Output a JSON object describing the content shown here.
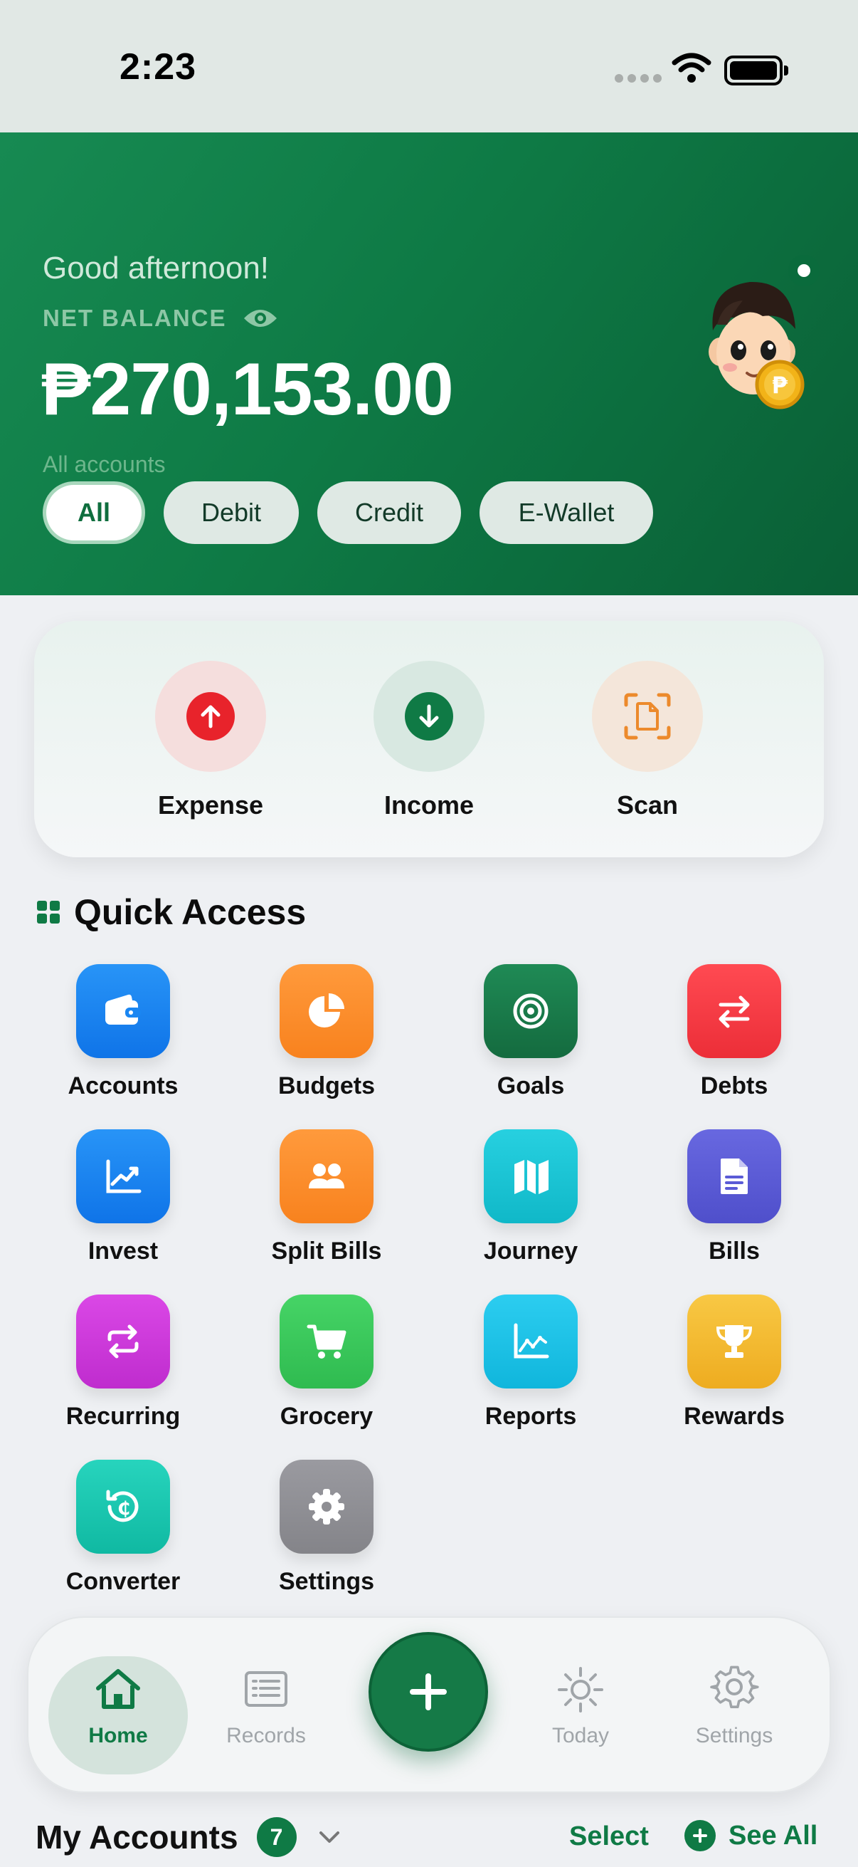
{
  "status_bar": {
    "time": "2:23"
  },
  "header": {
    "greeting": "Good afternoon!",
    "balance_label": "NET BALANCE",
    "balance": "₱270,153.00",
    "accounts_caption": "All accounts",
    "filters": [
      {
        "label": "All",
        "active": true
      },
      {
        "label": "Debit",
        "active": false
      },
      {
        "label": "Credit",
        "active": false
      },
      {
        "label": "E-Wallet",
        "active": false
      }
    ]
  },
  "actions": [
    {
      "label": "Expense",
      "icon": "arrow-up-icon",
      "color": "#e8232b"
    },
    {
      "label": "Income",
      "icon": "arrow-down-icon",
      "color": "#0f7a45"
    },
    {
      "label": "Scan",
      "icon": "scan-document-icon",
      "color": "#ec8a2c"
    }
  ],
  "quick_access": {
    "title": "Quick Access",
    "items": [
      {
        "label": "Accounts",
        "icon": "wallet-icon",
        "color": "#1a86f2"
      },
      {
        "label": "Budgets",
        "icon": "pie-chart-icon",
        "color": "#fb8a2a"
      },
      {
        "label": "Goals",
        "icon": "target-icon",
        "color": "#18784a"
      },
      {
        "label": "Debts",
        "icon": "swap-arrows-icon",
        "color": "#f23a44"
      },
      {
        "label": "Invest",
        "icon": "trend-chart-icon",
        "color": "#1a86f2"
      },
      {
        "label": "Split Bills",
        "icon": "people-icon",
        "color": "#fb8a2a"
      },
      {
        "label": "Journey",
        "icon": "map-icon",
        "color": "#16c6d8"
      },
      {
        "label": "Bills",
        "icon": "document-icon",
        "color": "#5a5bd6"
      },
      {
        "label": "Recurring",
        "icon": "repeat-icon",
        "color": "#cc36d8"
      },
      {
        "label": "Grocery",
        "icon": "cart-icon",
        "color": "#36c759"
      },
      {
        "label": "Reports",
        "icon": "line-chart-icon",
        "color": "#1ac4ea"
      },
      {
        "label": "Rewards",
        "icon": "trophy-icon",
        "color": "#f4bc34"
      },
      {
        "label": "Converter",
        "icon": "currency-convert-icon",
        "color": "#17c6b0"
      },
      {
        "label": "Settings",
        "icon": "gear-icon",
        "color": "#8e8e93"
      }
    ]
  },
  "bottom_nav": {
    "items": [
      {
        "label": "Home",
        "icon": "house-icon",
        "active": true
      },
      {
        "label": "Records",
        "icon": "records-icon",
        "active": false
      },
      {
        "label": "Today",
        "icon": "sun-icon",
        "active": false
      },
      {
        "label": "Settings",
        "icon": "gear-icon",
        "active": false
      }
    ],
    "fab_icon": "plus-icon"
  },
  "my_accounts": {
    "title": "My Accounts",
    "count": "7",
    "select_label": "Select",
    "see_all_label": "See All"
  },
  "colors": {
    "brand_green": "#0f7a45",
    "header_dark": "#0a5f36"
  }
}
